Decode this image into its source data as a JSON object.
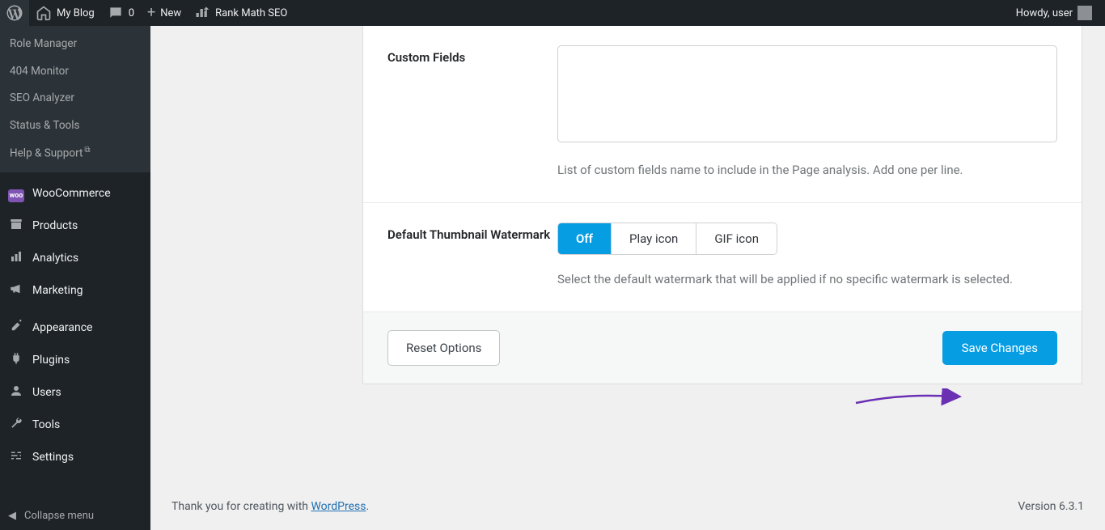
{
  "adminbar": {
    "site_title": "My Blog",
    "comment_count": "0",
    "new_label": "New",
    "rank_math_label": "Rank Math SEO",
    "howdy_prefix": "Howdy, ",
    "user_name": "user"
  },
  "submenu": {
    "items": [
      "Role Manager",
      "404 Monitor",
      "SEO Analyzer",
      "Status & Tools",
      "Help & Support"
    ]
  },
  "menu": {
    "items": [
      {
        "id": "woocommerce",
        "label": "WooCommerce",
        "icon": "woo"
      },
      {
        "id": "products",
        "label": "Products",
        "icon": "archive"
      },
      {
        "id": "analytics",
        "label": "Analytics",
        "icon": "bars"
      },
      {
        "id": "marketing",
        "label": "Marketing",
        "icon": "megaphone"
      },
      {
        "id": "appearance",
        "label": "Appearance",
        "icon": "brush"
      },
      {
        "id": "plugins",
        "label": "Plugins",
        "icon": "plug"
      },
      {
        "id": "users",
        "label": "Users",
        "icon": "person"
      },
      {
        "id": "tools",
        "label": "Tools",
        "icon": "wrench"
      },
      {
        "id": "settings",
        "label": "Settings",
        "icon": "sliders"
      }
    ],
    "collapse_label": "Collapse menu"
  },
  "settings": {
    "custom_fields": {
      "label": "Custom Fields",
      "value": "",
      "desc": "List of custom fields name to include in the Page analysis. Add one per line."
    },
    "watermark": {
      "label": "Default Thumbnail Watermark",
      "options": [
        "Off",
        "Play icon",
        "GIF icon"
      ],
      "selected": "Off",
      "desc": "Select the default watermark that will be applied if no specific watermark is selected."
    },
    "reset_label": "Reset Options",
    "save_label": "Save Changes"
  },
  "footer": {
    "thankyou_prefix": "Thank you for creating with ",
    "wordpress_label": "WordPress",
    "version_label": "Version 6.3.1"
  }
}
